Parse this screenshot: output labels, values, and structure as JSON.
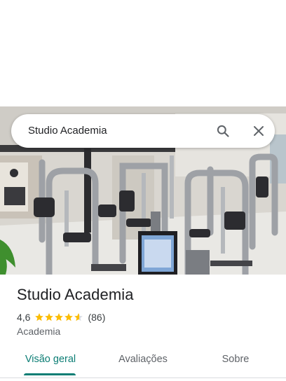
{
  "search": {
    "query": "Studio Academia",
    "search_icon": "search-icon",
    "close_icon": "close-icon"
  },
  "place": {
    "name": "Studio Academia",
    "rating": "4,6",
    "stars": 4.6,
    "review_count": "(86)",
    "category": "Academia"
  },
  "tabs": [
    {
      "label": "Visão geral",
      "active": true
    },
    {
      "label": "Avaliações",
      "active": false
    },
    {
      "label": "Sobre",
      "active": false
    }
  ],
  "colors": {
    "accent": "#0b7d74",
    "star": "#fbbc04",
    "star_empty": "#dadce0"
  }
}
